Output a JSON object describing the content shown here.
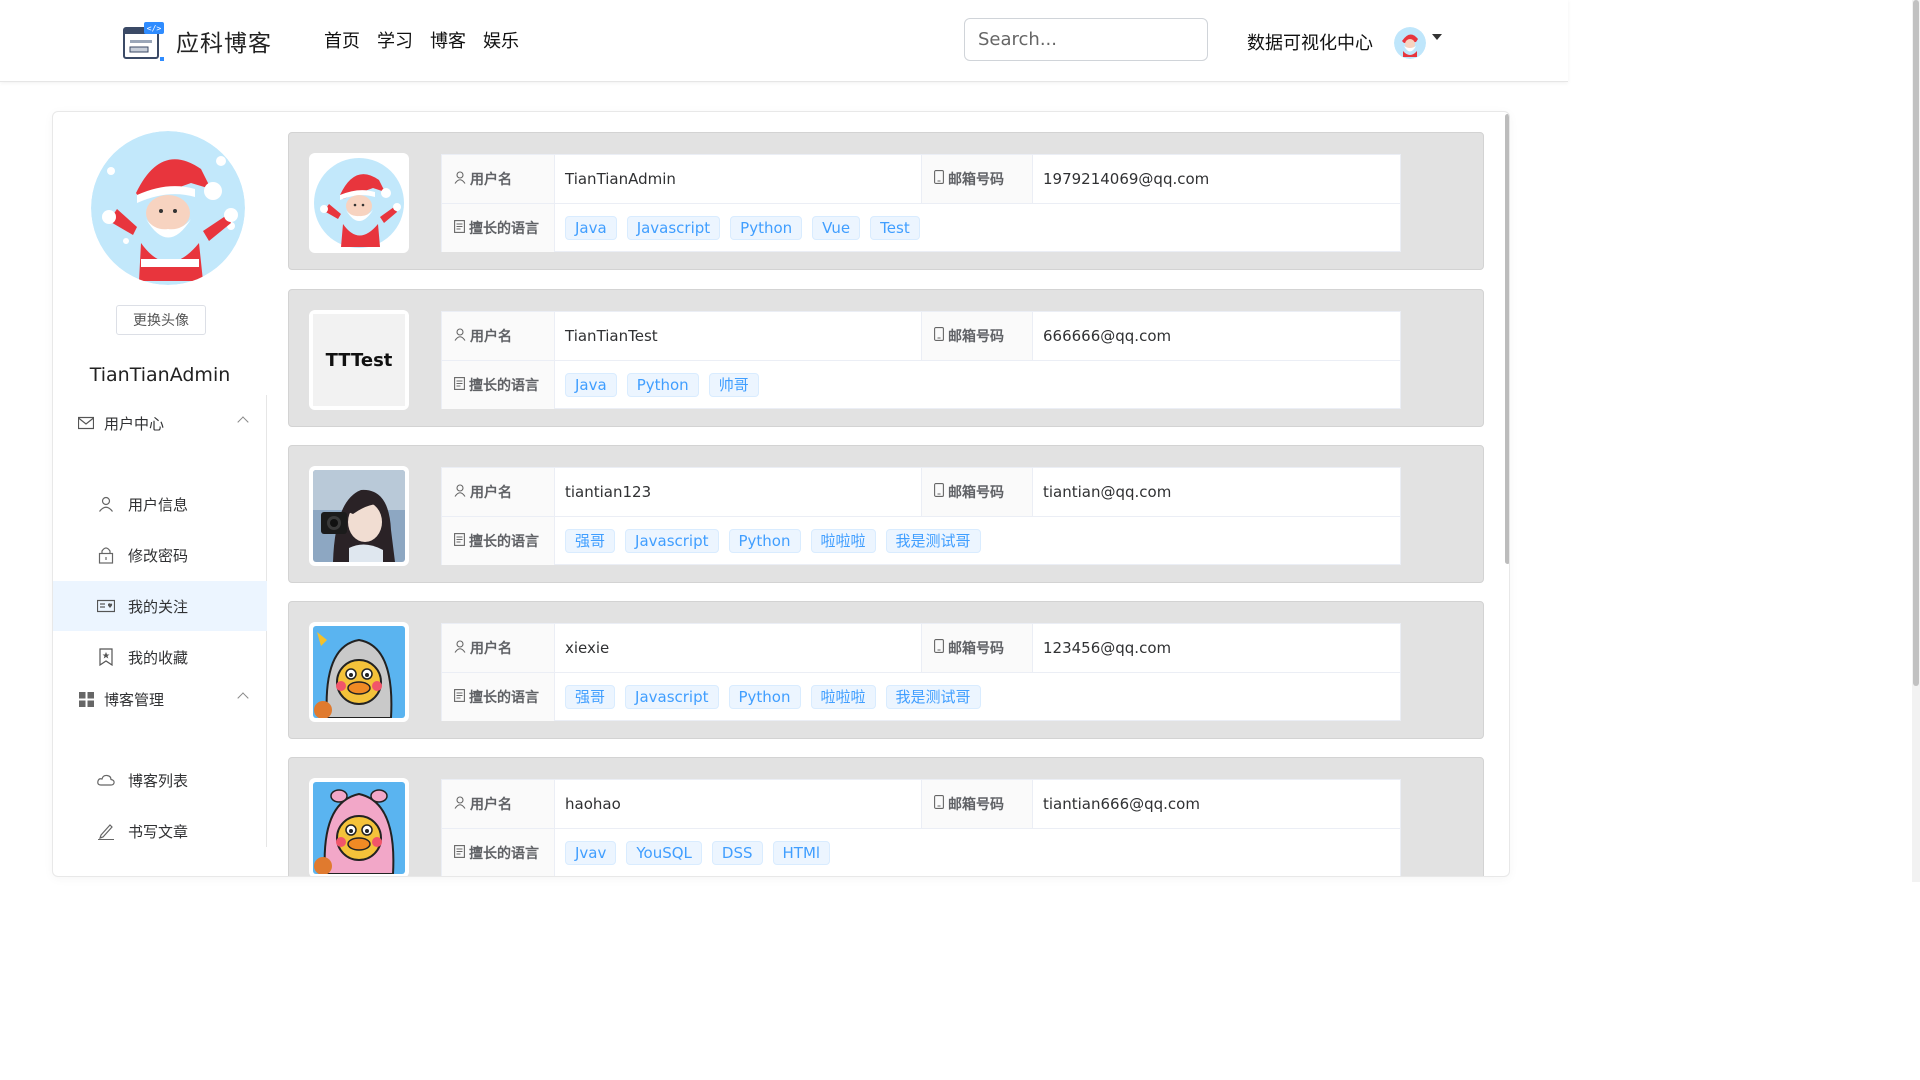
{
  "navbar": {
    "brand": "应科博客",
    "links": [
      "首页",
      "学习",
      "博客",
      "娱乐"
    ],
    "search_placeholder": "Search...",
    "dv_center": "数据可视化中心"
  },
  "sidebar": {
    "change_avatar": "更换头像",
    "username": "TianTianAdmin",
    "groups": [
      {
        "label": "用户中心",
        "items": [
          "用户信息",
          "修改密码",
          "我的关注",
          "我的收藏"
        ]
      },
      {
        "label": "博客管理",
        "items": [
          "博客列表",
          "书写文章"
        ]
      }
    ],
    "active_item": "我的关注"
  },
  "labels": {
    "username": "用户名",
    "email": "邮箱号码",
    "languages": "擅长的语言"
  },
  "follows": [
    {
      "username": "TianTianAdmin",
      "email": "1979214069@qq.com",
      "tags": [
        "Java",
        "Javascript",
        "Python",
        "Vue",
        "Test"
      ],
      "avatar": "santa"
    },
    {
      "username": "TianTianTest",
      "email": "666666@qq.com",
      "tags": [
        "Java",
        "Python",
        "帅哥"
      ],
      "avatar": "text",
      "avatar_text": "TTTest"
    },
    {
      "username": "tiantian123",
      "email": "tiantian@qq.com",
      "tags": [
        "强哥",
        "Javascript",
        "Python",
        "啦啦啦",
        "我是测试哥"
      ],
      "avatar": "photo"
    },
    {
      "username": "xiexie",
      "email": "123456@qq.com",
      "tags": [
        "强哥",
        "Javascript",
        "Python",
        "啦啦啦",
        "我是测试哥"
      ],
      "avatar": "duck-gray"
    },
    {
      "username": "haohao",
      "email": "tiantian666@qq.com",
      "tags": [
        "Jvav",
        "YouSQL",
        "DSS",
        "HTMl"
      ],
      "avatar": "duck-pink"
    }
  ],
  "colors": {
    "tag_text": "#409eff",
    "tag_bg": "#ecf5ff",
    "active_menu_bg": "#ecf5ff",
    "card_bg": "#e2e2e2"
  }
}
